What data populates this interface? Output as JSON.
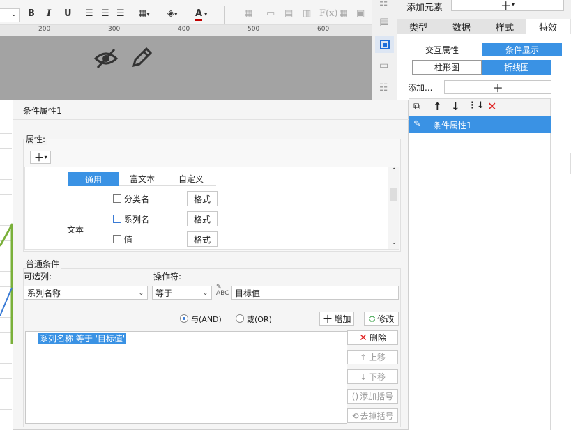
{
  "toolbar": {
    "bold": "B",
    "italic": "I",
    "underline": "U",
    "font_color": "A"
  },
  "ruler": {
    "ticks": [
      "200",
      "300",
      "400",
      "500",
      "600"
    ]
  },
  "right_panel": {
    "add_element_label": "添加元素",
    "tabs": [
      "类型",
      "数据",
      "样式",
      "特效"
    ],
    "active_tab": "特效",
    "sub_tabs": [
      "交互属性",
      "条件显示"
    ],
    "chart_tabs": [
      "柱形图",
      "折线图"
    ],
    "add_label": "添加...",
    "list_items": [
      "条件属性1"
    ]
  },
  "dialog": {
    "title": "条件属性1",
    "property_label": "属性:",
    "prop_tabs": [
      "通用",
      "富文本",
      "自定义"
    ],
    "text_label": "文本",
    "checkboxes": [
      {
        "label": "分类名",
        "button": "格式"
      },
      {
        "label": "系列名",
        "button": "格式"
      },
      {
        "label": "值",
        "button": "格式"
      }
    ],
    "condition_group": "普通条件",
    "column_label": "可选列:",
    "operator_label": "操作符:",
    "column_value": "系列名称",
    "operator_value": "等于",
    "target_value": "目标值",
    "and_label": "与(AND)",
    "or_label": "或(OR)",
    "add_btn": "增加",
    "modify_btn": "修改",
    "condition_item": "系列名称 等于 '目标值'",
    "side_buttons": [
      "删除",
      "上移",
      "下移",
      "添加括号",
      "去掉括号"
    ]
  }
}
